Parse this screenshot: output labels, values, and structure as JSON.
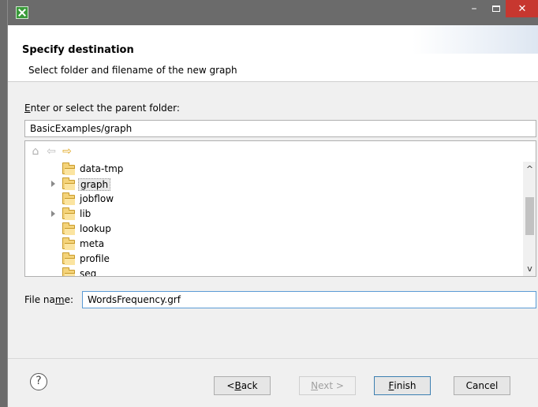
{
  "window": {
    "title": "",
    "close_glyph": "✕",
    "minimize_glyph": "–"
  },
  "header": {
    "title": "Specify destination",
    "description": "Select folder and filename of the new graph"
  },
  "parent_folder": {
    "label_mnemonic": "E",
    "label_rest": "nter or select the parent folder:",
    "value": "BasicExamples/graph"
  },
  "tree": {
    "toolbar": {
      "home_glyph": "⌂",
      "back_glyph": "⇦",
      "forward_glyph": "⇨"
    },
    "items": [
      {
        "label": "data-tmp",
        "expandable": false,
        "selected": false
      },
      {
        "label": "graph",
        "expandable": true,
        "selected": true
      },
      {
        "label": "jobflow",
        "expandable": false,
        "selected": false
      },
      {
        "label": "lib",
        "expandable": true,
        "selected": false
      },
      {
        "label": "lookup",
        "expandable": false,
        "selected": false
      },
      {
        "label": "meta",
        "expandable": false,
        "selected": false
      },
      {
        "label": "profile",
        "expandable": false,
        "selected": false
      },
      {
        "label": "seq",
        "expandable": false,
        "selected": false
      }
    ],
    "scroll_up_glyph": "^",
    "scroll_down_glyph": "v"
  },
  "file_name": {
    "label_pre": "File na",
    "label_mnemonic": "m",
    "label_post": "e:",
    "value": "WordsFrequency.grf"
  },
  "buttons": {
    "help_glyph": "?",
    "back_pre": "< ",
    "back_mnemonic": "B",
    "back_post": "ack",
    "next_mnemonic": "N",
    "next_post": "ext >",
    "finish_mnemonic": "F",
    "finish_post": "inish",
    "cancel": "Cancel"
  },
  "colors": {
    "titlebar": "#6b6b6b",
    "close_button": "#c7372f",
    "folder": "#f4d37a",
    "focus_border": "#5b9bd5"
  }
}
